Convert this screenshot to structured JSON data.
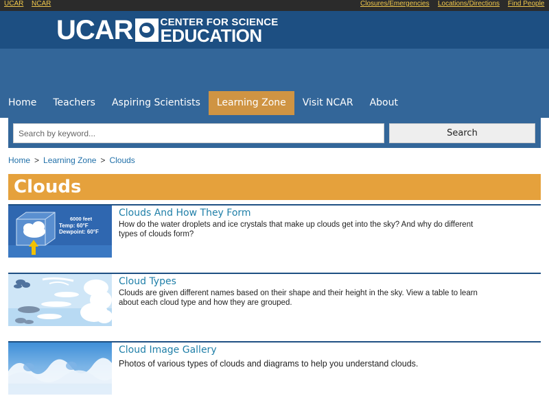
{
  "utility": {
    "links_left": [
      "UCAR",
      "NCAR"
    ],
    "links_right": [
      "Closures/Emergencies",
      "Locations/Directions",
      "Find People"
    ]
  },
  "logo": {
    "ucar": "UCAR",
    "line1": "CENTER FOR SCIENCE",
    "line2": "EDUCATION"
  },
  "nav": {
    "items": [
      "Home",
      "Teachers",
      "Aspiring Scientists",
      "Learning Zone",
      "Visit NCAR",
      "About"
    ],
    "active": "Learning Zone"
  },
  "search": {
    "placeholder": "Search by keyword...",
    "value": "",
    "button_label": "Search"
  },
  "breadcrumb": {
    "items": [
      "Home",
      "Learning Zone",
      "Clouds"
    ],
    "separator": ">"
  },
  "page": {
    "title": "Clouds"
  },
  "items": [
    {
      "title": "Clouds And How They Form",
      "description": "How do the water droplets and ice crystals that make up clouds get into the sky? And why do different types of clouds form?",
      "thumb_text": {
        "altitude": "6000 feet",
        "temp": "Temp:      60°F",
        "dewpoint": "Dewpoint: 60°F"
      }
    },
    {
      "title": "Cloud Types",
      "description": "Clouds are given different names based on their shape and their height in the sky. View a table to learn about each cloud type and how they are grouped."
    },
    {
      "title": "Cloud Image Gallery",
      "description": "Photos of various types of clouds and diagrams to help you understand clouds."
    }
  ],
  "colors": {
    "header": "#1d4f82",
    "banner": "#336699",
    "nav_active": "#cf9443",
    "title_bar": "#e5a13c",
    "link": "#1f7fa8"
  }
}
